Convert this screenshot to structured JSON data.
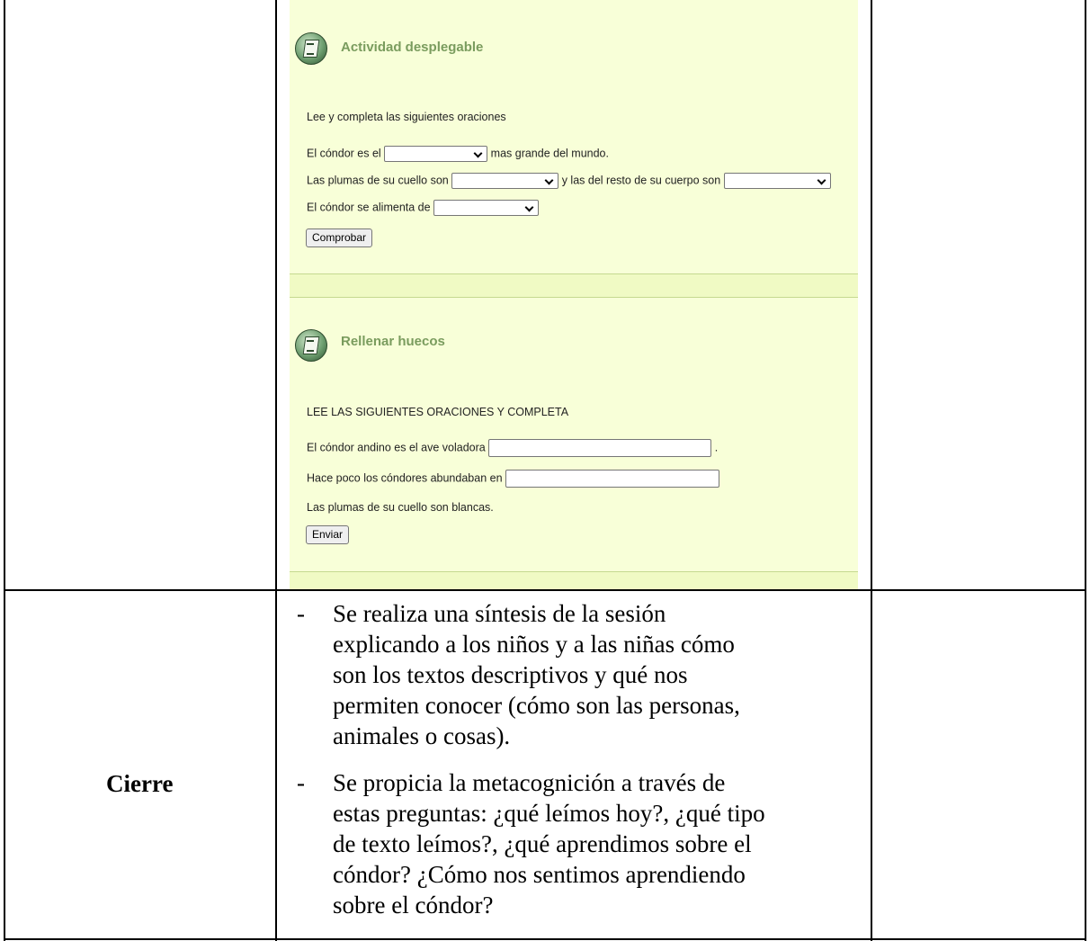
{
  "actividad_desplegable": {
    "title": "Actividad desplegable",
    "instruction": "Lee y completa las siguientes oraciones",
    "line1_before": "El cóndor es el",
    "line1_after": "mas grande del mundo.",
    "line2_before": "Las plumas de su cuello son",
    "line2_middle": "y las del resto de su cuerpo son",
    "line3_before": "El cóndor se alimenta de",
    "button_label": "Comprobar"
  },
  "rellenar_huecos": {
    "title": "Rellenar huecos",
    "instruction": "LEE LAS SIGUIENTES ORACIONES Y COMPLETA",
    "line1_before": "El cóndor andino es el ave voladora",
    "line1_after": ".",
    "line2_before": "Hace poco los cóndores abundaban en",
    "line3": "Las plumas de su cuello son blancas.",
    "button_label": "Enviar"
  },
  "cierre": {
    "label": "Cierre",
    "dash": "-",
    "bullets": [
      {
        "lines": [
          "Se realiza una síntesis de la sesión",
          "explicando a los niños y a las niñas cómo",
          "son los textos descriptivos y qué nos",
          "permiten conocer (cómo son las personas,",
          "animales o cosas)."
        ]
      },
      {
        "lines": [
          "Se propicia la metacognición a través de",
          "estas preguntas: ¿qué leímos hoy?, ¿qué tipo",
          "de texto leímos?, ¿qué aprendimos sobre el",
          "cóndor? ¿Cómo nos sentimos aprendiendo",
          "sobre el cóndor?"
        ]
      }
    ]
  }
}
